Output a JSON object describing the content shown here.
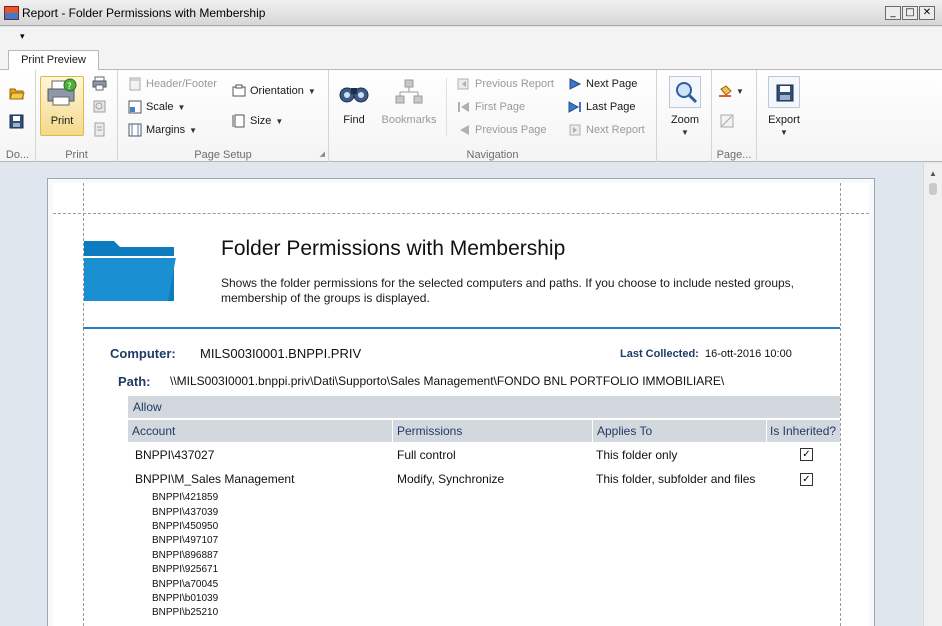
{
  "window": {
    "title": "Report - Folder Permissions with Membership",
    "controls": {
      "minimize": "_",
      "maximize": "□",
      "close": "✕"
    }
  },
  "qat_arrow": "▾",
  "tabs": {
    "active": "Print Preview"
  },
  "ribbon": {
    "groups": {
      "document": "Do...",
      "print": "Print",
      "page_setup": "Page Setup",
      "navigation": "Navigation",
      "zoom": "",
      "page_bg": "Page...",
      "export": ""
    },
    "buttons": {
      "print": "Print",
      "header_footer": "Header/Footer",
      "scale": "Scale",
      "margins": "Margins",
      "orientation": "Orientation",
      "size": "Size",
      "find": "Find",
      "bookmarks": "Bookmarks",
      "previous_report": "Previous Report",
      "first_page": "First Page",
      "previous_page": "Previous Page",
      "next_page": "Next  Page",
      "last_page": "Last  Page",
      "next_report": "Next Report",
      "zoom": "Zoom",
      "export": "Export"
    }
  },
  "report": {
    "title": "Folder Permissions with Membership",
    "description": "Shows the folder permissions for the selected computers and paths. If you choose to include nested groups, membership of the groups is displayed.",
    "computer_label": "Computer:",
    "computer_value": "MILS003I0001.BNPPI.PRIV",
    "last_collected_label": "Last Collected:",
    "last_collected_value": "16-ott-2016 10:00",
    "path_label": "Path:",
    "path_value": "\\\\MILS003I0001.bnppi.priv\\Dati\\Supporto\\Sales  Management\\FONDO  BNL  PORTFOLIO  IMMOBILIARE\\",
    "section": "Allow",
    "columns": [
      "Account",
      "Permissions",
      "Applies To",
      "Is Inherited?"
    ],
    "rows": [
      {
        "account": "BNPPI\\437027",
        "permissions": "Full control",
        "applies_to": "This folder only",
        "inherited": "✓"
      },
      {
        "account": "BNPPI\\M_Sales Management",
        "permissions": "Modify, Synchronize",
        "applies_to": "This folder, subfolder and files",
        "inherited": "✓"
      }
    ],
    "members": [
      "BNPPI\\421859",
      "BNPPI\\437039",
      "BNPPI\\450950",
      "BNPPI\\497107",
      "BNPPI\\896887",
      "BNPPI\\925671",
      "BNPPI\\a70045",
      "BNPPI\\b01039",
      "BNPPI\\b25210"
    ]
  }
}
